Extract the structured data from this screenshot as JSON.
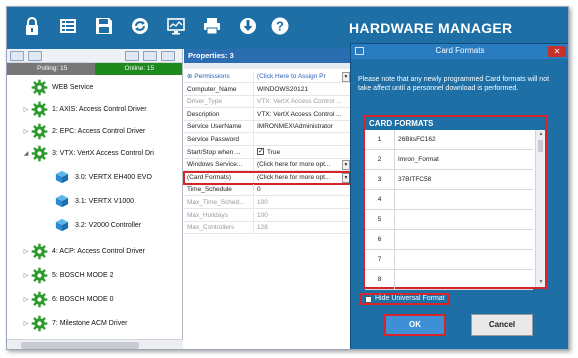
{
  "app": {
    "title": "HARDWARE MANAGER"
  },
  "toolbar": {
    "icons": [
      "lock-icon",
      "list-icon",
      "save-icon",
      "refresh-icon",
      "monitor-icon",
      "printer-icon",
      "download-icon",
      "help-icon"
    ]
  },
  "tree": {
    "polling_label": "Polling: 15",
    "online_label": "Online: 15",
    "nodes": [
      {
        "label": "WEB Service",
        "level": 0,
        "type": "gear",
        "expander": ""
      },
      {
        "label": "1:  AXIS: Access Control Driver",
        "level": 0,
        "type": "gear",
        "expander": "▷"
      },
      {
        "label": "2:  EPC: Access Control Driver",
        "level": 0,
        "type": "gear",
        "expander": "▷"
      },
      {
        "label": "3:  VTX: VertX Access Control Dri",
        "level": 0,
        "type": "gear",
        "expander": "◢"
      },
      {
        "label": "3.0:  VERTX EH400 EVO",
        "level": 1,
        "type": "cube",
        "expander": ""
      },
      {
        "label": "3.1:  VERTX V1000",
        "level": 1,
        "type": "cube",
        "expander": ""
      },
      {
        "label": "3.2:  V2000 Controller",
        "level": 1,
        "type": "cube",
        "expander": ""
      },
      {
        "label": "4:  ACP: Access Control Driver",
        "level": 0,
        "type": "gear",
        "expander": "▷"
      },
      {
        "label": "5:  BOSCH MODE 2",
        "level": 0,
        "type": "gear",
        "expander": "▷"
      },
      {
        "label": "6:  BOSCH MODE 0",
        "level": 0,
        "type": "gear",
        "expander": "▷"
      },
      {
        "label": "7:  Milestone ACM Driver",
        "level": 0,
        "type": "gear",
        "expander": "▷"
      }
    ]
  },
  "properties": {
    "header": "Properties: 3",
    "rows": [
      {
        "name": "⊕ Permissions",
        "value": "(Click Here to Assign Pr",
        "style": "link",
        "dropdown": true
      },
      {
        "name": "Computer_Name",
        "value": "WINDOWS20121",
        "style": "",
        "dropdown": false
      },
      {
        "name": "Driver_Type",
        "value": "VTX: VertX Access Control ...",
        "style": "disabled",
        "dropdown": false
      },
      {
        "name": "Description",
        "value": "VTX: VertX Access Control ...",
        "style": "",
        "dropdown": false
      },
      {
        "name": "Service UserName",
        "value": "IMRONMEX\\Administrator",
        "style": "",
        "dropdown": false
      },
      {
        "name": "Service Password",
        "value": "",
        "style": "",
        "dropdown": false
      },
      {
        "name": "Start/Stop when ...",
        "value": "True",
        "style": "check",
        "dropdown": false
      },
      {
        "name": "Windows Service...",
        "value": "(Click here for more opt...",
        "style": "",
        "dropdown": true
      },
      {
        "name": "(Card Formats)",
        "value": "(Click here for more opt...",
        "style": "hl",
        "dropdown": true
      },
      {
        "name": "Time_Schedule",
        "value": "0",
        "style": "",
        "dropdown": false
      },
      {
        "name": "Max_Time_Sched...",
        "value": "100",
        "style": "disabled",
        "dropdown": false
      },
      {
        "name": "Max_Holidays",
        "value": "100",
        "style": "disabled",
        "dropdown": false
      },
      {
        "name": "Max_Controllers",
        "value": "128",
        "style": "disabled",
        "dropdown": false
      }
    ]
  },
  "dialog": {
    "title": "Card Formats",
    "close_label": "✕",
    "note": "Please note that any newly programmed Card formats will not take affect until a personnel download is performed.",
    "list_header": "CARD FORMATS",
    "rows": [
      {
        "index": "1",
        "format": "26BitsFC162"
      },
      {
        "index": "2",
        "format": "Imron_Format"
      },
      {
        "index": "3",
        "format": "37BITFC58"
      },
      {
        "index": "4",
        "format": ""
      },
      {
        "index": "5",
        "format": ""
      },
      {
        "index": "6",
        "format": ""
      },
      {
        "index": "7",
        "format": ""
      },
      {
        "index": "8",
        "format": ""
      }
    ],
    "hide_universal_label": "Hide Universal Format",
    "ok_label": "OK",
    "cancel_label": "Cancel"
  }
}
